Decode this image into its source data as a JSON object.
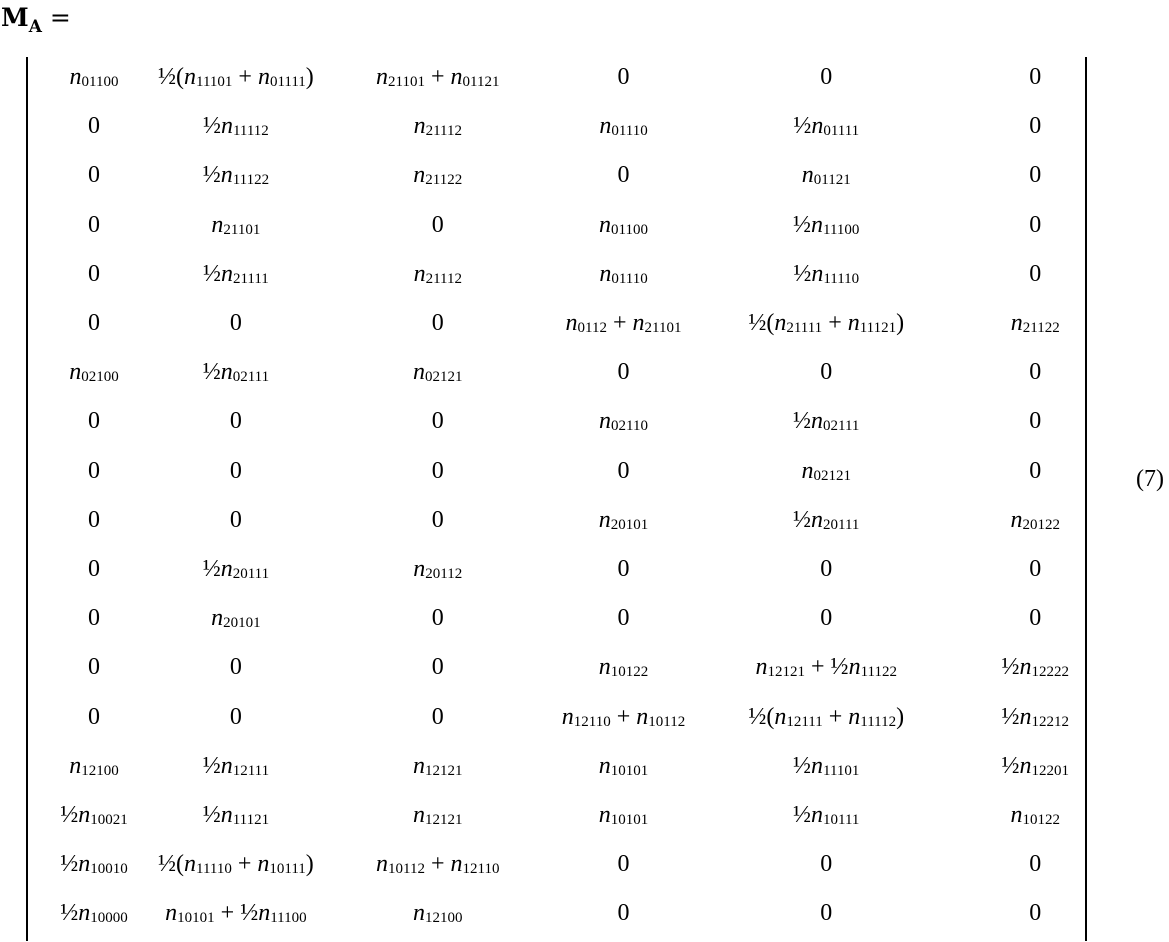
{
  "lhs": {
    "symbol": "M",
    "subscript": "A",
    "equals": "="
  },
  "equation_number": "(7)",
  "matrix": {
    "rows": [
      [
        [
          {
            "v": "n",
            "s": "01100"
          }
        ],
        [
          {
            "t": "½("
          },
          {
            "v": "n",
            "s": "11101"
          },
          {
            "t": " + "
          },
          {
            "v": "n",
            "s": "01111"
          },
          {
            "t": ")"
          }
        ],
        [
          {
            "v": "n",
            "s": "21101"
          },
          {
            "t": " + "
          },
          {
            "v": "n",
            "s": "01121"
          }
        ],
        [
          {
            "t": "0"
          }
        ],
        [
          {
            "t": "0"
          }
        ],
        [
          {
            "t": "0"
          }
        ]
      ],
      [
        [
          {
            "t": "0"
          }
        ],
        [
          {
            "t": "½"
          },
          {
            "v": "n",
            "s": "11112"
          }
        ],
        [
          {
            "v": "n",
            "s": "21112"
          }
        ],
        [
          {
            "v": "n",
            "s": "01110"
          }
        ],
        [
          {
            "t": "½"
          },
          {
            "v": "n",
            "s": "01111"
          }
        ],
        [
          {
            "t": "0"
          }
        ]
      ],
      [
        [
          {
            "t": "0"
          }
        ],
        [
          {
            "t": "½"
          },
          {
            "v": "n",
            "s": "11122"
          }
        ],
        [
          {
            "v": "n",
            "s": "21122"
          }
        ],
        [
          {
            "t": "0"
          }
        ],
        [
          {
            "v": "n",
            "s": "01121"
          }
        ],
        [
          {
            "t": "0"
          }
        ]
      ],
      [
        [
          {
            "t": "0"
          }
        ],
        [
          {
            "v": "n",
            "s": "21101"
          }
        ],
        [
          {
            "t": "0"
          }
        ],
        [
          {
            "v": "n",
            "s": "01100"
          }
        ],
        [
          {
            "t": "½"
          },
          {
            "v": "n",
            "s": "11100"
          }
        ],
        [
          {
            "t": "0"
          }
        ]
      ],
      [
        [
          {
            "t": "0"
          }
        ],
        [
          {
            "t": "½"
          },
          {
            "v": "n",
            "s": "21111"
          }
        ],
        [
          {
            "v": "n",
            "s": "21112"
          }
        ],
        [
          {
            "v": "n",
            "s": "01110"
          }
        ],
        [
          {
            "t": "½"
          },
          {
            "v": "n",
            "s": "11110"
          }
        ],
        [
          {
            "t": "0"
          }
        ]
      ],
      [
        [
          {
            "t": "0"
          }
        ],
        [
          {
            "t": "0"
          }
        ],
        [
          {
            "t": "0"
          }
        ],
        [
          {
            "v": "n",
            "s": "0112"
          },
          {
            "t": " + "
          },
          {
            "v": "n",
            "s": "21101"
          }
        ],
        [
          {
            "t": "½("
          },
          {
            "v": "n",
            "s": "21111"
          },
          {
            "t": " + "
          },
          {
            "v": "n",
            "s": "11121"
          },
          {
            "t": ")"
          }
        ],
        [
          {
            "v": "n",
            "s": "21122"
          }
        ]
      ],
      [
        [
          {
            "v": "n",
            "s": "02100"
          }
        ],
        [
          {
            "t": "½"
          },
          {
            "v": "n",
            "s": "02111"
          }
        ],
        [
          {
            "v": "n",
            "s": "02121"
          }
        ],
        [
          {
            "t": "0"
          }
        ],
        [
          {
            "t": "0"
          }
        ],
        [
          {
            "t": "0"
          }
        ]
      ],
      [
        [
          {
            "t": "0"
          }
        ],
        [
          {
            "t": "0"
          }
        ],
        [
          {
            "t": "0"
          }
        ],
        [
          {
            "v": "n",
            "s": "02110"
          }
        ],
        [
          {
            "t": "½"
          },
          {
            "v": "n",
            "s": "02111"
          }
        ],
        [
          {
            "t": "0"
          }
        ]
      ],
      [
        [
          {
            "t": "0"
          }
        ],
        [
          {
            "t": "0"
          }
        ],
        [
          {
            "t": "0"
          }
        ],
        [
          {
            "t": "0"
          }
        ],
        [
          {
            "v": "n",
            "s": "02121"
          }
        ],
        [
          {
            "t": "0"
          }
        ]
      ],
      [
        [
          {
            "t": "0"
          }
        ],
        [
          {
            "t": "0"
          }
        ],
        [
          {
            "t": "0"
          }
        ],
        [
          {
            "v": "n",
            "s": "20101"
          }
        ],
        [
          {
            "t": "½"
          },
          {
            "v": "n",
            "s": "20111"
          }
        ],
        [
          {
            "v": "n",
            "s": "20122"
          }
        ]
      ],
      [
        [
          {
            "t": "0"
          }
        ],
        [
          {
            "t": "½"
          },
          {
            "v": "n",
            "s": "20111"
          }
        ],
        [
          {
            "v": "n",
            "s": "20112"
          }
        ],
        [
          {
            "t": "0"
          }
        ],
        [
          {
            "t": "0"
          }
        ],
        [
          {
            "t": "0"
          }
        ]
      ],
      [
        [
          {
            "t": "0"
          }
        ],
        [
          {
            "v": "n",
            "s": "20101"
          }
        ],
        [
          {
            "t": "0"
          }
        ],
        [
          {
            "t": "0"
          }
        ],
        [
          {
            "t": "0"
          }
        ],
        [
          {
            "t": "0"
          }
        ]
      ],
      [
        [
          {
            "t": "0"
          }
        ],
        [
          {
            "t": "0"
          }
        ],
        [
          {
            "t": "0"
          }
        ],
        [
          {
            "v": "n",
            "s": "10122"
          }
        ],
        [
          {
            "v": "n",
            "s": "12121"
          },
          {
            "t": " + ½"
          },
          {
            "v": "n",
            "s": "11122"
          }
        ],
        [
          {
            "t": "½"
          },
          {
            "v": "n",
            "s": "12222"
          }
        ]
      ],
      [
        [
          {
            "t": "0"
          }
        ],
        [
          {
            "t": "0"
          }
        ],
        [
          {
            "t": "0"
          }
        ],
        [
          {
            "v": "n",
            "s": "12110"
          },
          {
            "t": " + "
          },
          {
            "v": "n",
            "s": "10112"
          }
        ],
        [
          {
            "t": "½("
          },
          {
            "v": "n",
            "s": "12111"
          },
          {
            "t": " + "
          },
          {
            "v": "n",
            "s": "11112"
          },
          {
            "t": ")"
          }
        ],
        [
          {
            "t": "½"
          },
          {
            "v": "n",
            "s": "12212"
          }
        ]
      ],
      [
        [
          {
            "v": "n",
            "s": "12100"
          }
        ],
        [
          {
            "t": "½"
          },
          {
            "v": "n",
            "s": "12111"
          }
        ],
        [
          {
            "v": "n",
            "s": "12121"
          }
        ],
        [
          {
            "v": "n",
            "s": "10101"
          }
        ],
        [
          {
            "t": "½"
          },
          {
            "v": "n",
            "s": "11101"
          }
        ],
        [
          {
            "t": "½"
          },
          {
            "v": "n",
            "s": "12201"
          }
        ]
      ],
      [
        [
          {
            "t": "½"
          },
          {
            "v": "n",
            "s": "10021"
          }
        ],
        [
          {
            "t": "½"
          },
          {
            "v": "n",
            "s": "11121"
          }
        ],
        [
          {
            "v": "n",
            "s": "12121"
          }
        ],
        [
          {
            "v": "n",
            "s": "10101"
          }
        ],
        [
          {
            "t": "½"
          },
          {
            "v": "n",
            "s": "10111"
          }
        ],
        [
          {
            "v": "n",
            "s": "10122"
          }
        ]
      ],
      [
        [
          {
            "t": "½"
          },
          {
            "v": "n",
            "s": "10010"
          }
        ],
        [
          {
            "t": "½("
          },
          {
            "v": "n",
            "s": "11110"
          },
          {
            "t": " + "
          },
          {
            "v": "n",
            "s": "10111"
          },
          {
            "t": ")"
          }
        ],
        [
          {
            "v": "n",
            "s": "10112"
          },
          {
            "t": " + "
          },
          {
            "v": "n",
            "s": "12110"
          }
        ],
        [
          {
            "t": "0"
          }
        ],
        [
          {
            "t": "0"
          }
        ],
        [
          {
            "t": "0"
          }
        ]
      ],
      [
        [
          {
            "t": "½"
          },
          {
            "v": "n",
            "s": "10000"
          }
        ],
        [
          {
            "v": "n",
            "s": "10101"
          },
          {
            "t": " + ½"
          },
          {
            "v": "n",
            "s": "11100"
          }
        ],
        [
          {
            "v": "n",
            "s": "12100"
          }
        ],
        [
          {
            "t": "0"
          }
        ],
        [
          {
            "t": "0"
          }
        ],
        [
          {
            "t": "0"
          }
        ]
      ]
    ]
  }
}
